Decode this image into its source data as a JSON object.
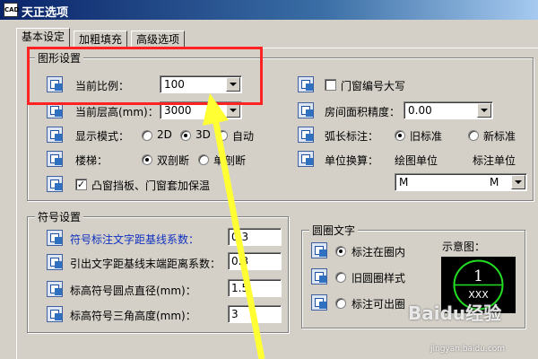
{
  "window": {
    "title": "天正选项",
    "app_icon": "CAD"
  },
  "tabs": [
    {
      "label": "基本设定",
      "active": true
    },
    {
      "label": "加粗填充",
      "active": false
    },
    {
      "label": "高级选项",
      "active": false
    }
  ],
  "graphics": {
    "group_title": "图形设置",
    "scale": {
      "label": "当前比例：",
      "value": "100"
    },
    "layer_height": {
      "label": "当前层高(mm)：",
      "value": "3000"
    },
    "display_mode": {
      "label": "显示模式：",
      "options": [
        "2D",
        "3D",
        "自动"
      ],
      "selected": "3D"
    },
    "stairs": {
      "label": "楼梯：",
      "options": [
        "双剖断",
        "单剖断"
      ],
      "selected": "双剖断"
    },
    "bay_window": {
      "label": "凸窗挡板、门窗套加保温",
      "checked": true
    },
    "door_caps": {
      "label": "门窗编号大写",
      "checked": false
    },
    "room_area": {
      "label": "房间面积精度：",
      "value": "0.00"
    },
    "arc_length": {
      "label": "弧长标注：",
      "options": [
        "旧标准",
        "新标准"
      ],
      "selected": "旧标准"
    },
    "unit_convert": {
      "label": "单位换算：",
      "drawing_unit": "绘图单位",
      "dim_unit": "标注单位",
      "value_left": "M",
      "value_right": "M"
    }
  },
  "symbols": {
    "group_title": "符号设置",
    "rows": [
      {
        "label": "符号标注文字距基线系数：",
        "value": "0.3",
        "highlight": true
      },
      {
        "label": "引出文字距基线末端距离系数：",
        "value": "0.3",
        "highlight": false
      },
      {
        "label": "标高符号圆点直径(mm)：",
        "value": "1.5",
        "highlight": false
      },
      {
        "label": "标高符号三角高度(mm)：",
        "value": "3",
        "highlight": false
      }
    ]
  },
  "circle_text": {
    "group_title": "圆圈文字",
    "options": [
      "标注在圈内",
      "旧圆圈样式",
      "标注可出圈"
    ],
    "selected": "标注在圈内",
    "preview_label": "示意图：",
    "preview_number": "1",
    "preview_text": "XXX"
  },
  "watermark": {
    "brand": "Baidu经验",
    "url": "jingyan.baidu.com"
  },
  "colors": {
    "annotation": "#ff2222",
    "arrow": "#ffff33",
    "preview_stroke": "#22dd22"
  }
}
